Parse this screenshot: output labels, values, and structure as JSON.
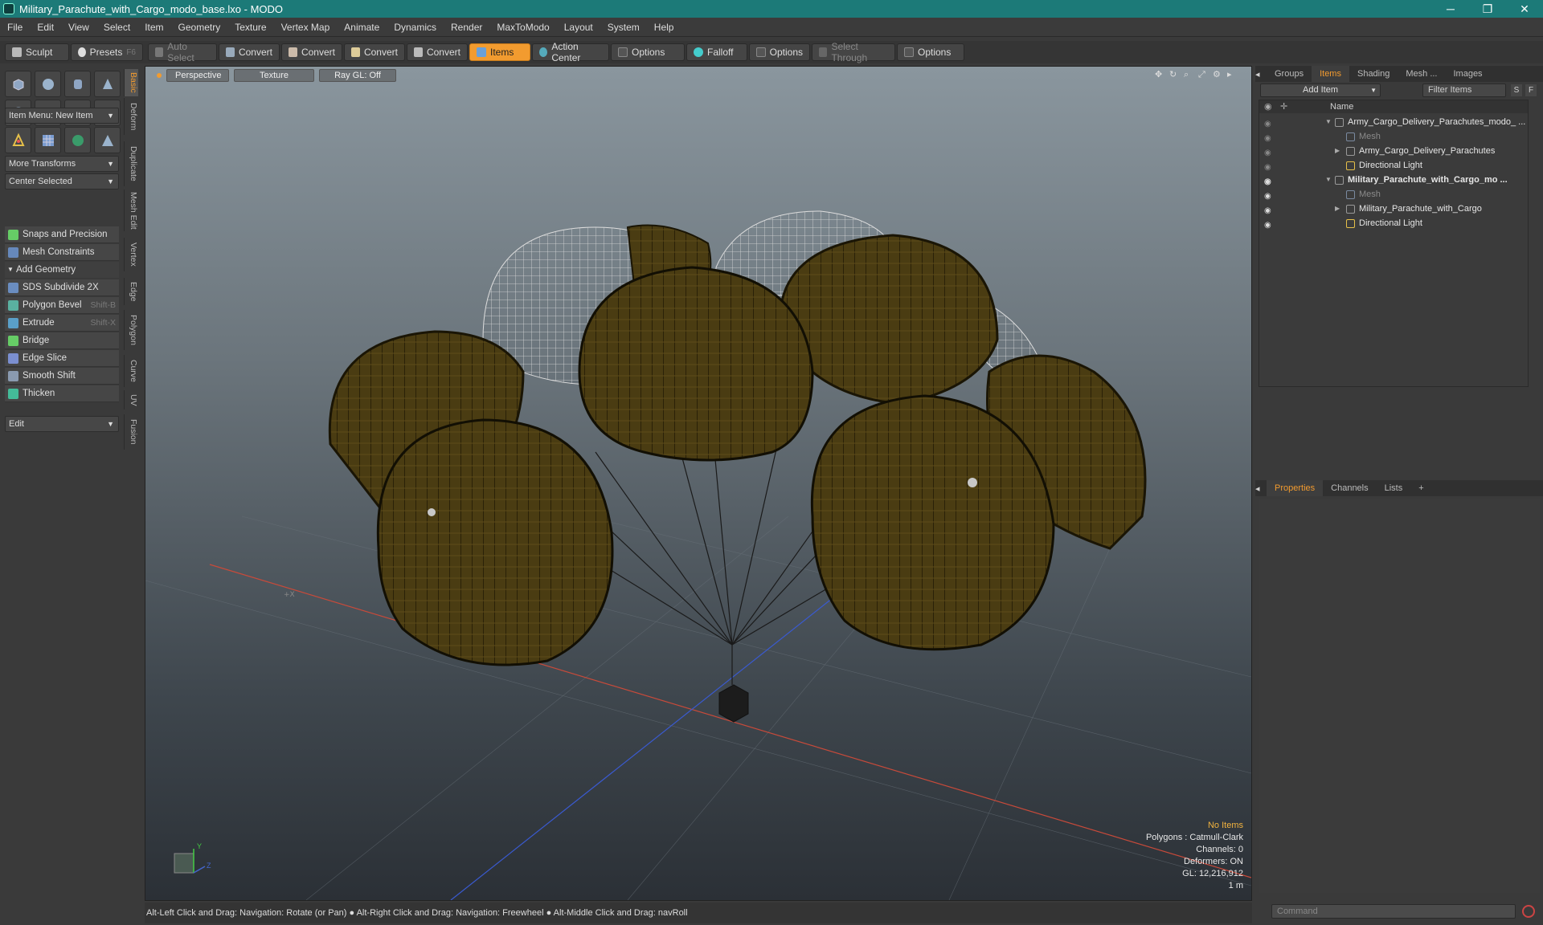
{
  "window": {
    "title": "Military_Parachute_with_Cargo_modo_base.lxo - MODO",
    "min": "─",
    "max": "❐",
    "close": "✕"
  },
  "menu": [
    "File",
    "Edit",
    "View",
    "Select",
    "Item",
    "Geometry",
    "Texture",
    "Vertex Map",
    "Animate",
    "Dynamics",
    "Render",
    "MaxToModo",
    "Layout",
    "System",
    "Help"
  ],
  "toolbar": {
    "sculpt": "Sculpt",
    "presets": "Presets",
    "presets_key": "F6",
    "auto_select": "Auto Select",
    "convert1": "Convert",
    "convert2": "Convert",
    "convert3": "Convert",
    "convert4": "Convert",
    "items": "Items",
    "action_center": "Action Center",
    "options1": "Options",
    "falloff": "Falloff",
    "options2": "Options",
    "select_through": "Select Through",
    "options3": "Options"
  },
  "left": {
    "item_menu": "Item Menu: New Item",
    "more_transforms": "More Transforms",
    "center_selected": "Center Selected",
    "snaps": "Snaps and Precision",
    "mesh_constraints": "Mesh Constraints",
    "add_geometry": "Add Geometry",
    "tools": [
      {
        "label": "SDS Subdivide 2X",
        "key": ""
      },
      {
        "label": "Polygon Bevel",
        "key": "Shift-B"
      },
      {
        "label": "Extrude",
        "key": "Shift-X"
      },
      {
        "label": "Bridge",
        "key": ""
      },
      {
        "label": "Edge Slice",
        "key": ""
      },
      {
        "label": "Smooth Shift",
        "key": ""
      },
      {
        "label": "Thicken",
        "key": ""
      }
    ],
    "edit": "Edit",
    "vtabs": [
      "Basic",
      "Deform",
      "Duplicate",
      "Mesh Edit",
      "Vertex",
      "Edge",
      "Polygon",
      "Curve",
      "UV",
      "Fusion"
    ]
  },
  "viewport": {
    "perspective": "Perspective",
    "texture": "Texture",
    "raygl": "Ray GL: Off",
    "hud": {
      "no_items": "No Items",
      "polygons": "Polygons : Catmull-Clark",
      "channels": "Channels: 0",
      "deformers": "Deformers: ON",
      "gl": "GL: 12,216,912",
      "scale": "1 m"
    },
    "axis_y": "Y",
    "axis_z": "Z"
  },
  "status": "Alt-Left Click and Drag: Navigation: Rotate (or Pan) ● Alt-Right Click and Drag: Navigation: Freewheel ● Alt-Middle Click and Drag: navRoll",
  "right": {
    "tabs_top": [
      "Groups",
      "Items",
      "Shading",
      "Mesh ...",
      "Images"
    ],
    "add_item": "Add Item",
    "filter_items": "Filter Items",
    "filter_s": "S",
    "filter_f": "F",
    "name_col": "Name",
    "tree": [
      {
        "label": "Army_Cargo_Delivery_Parachutes_modo_ ...",
        "bold": false
      },
      {
        "label": "Mesh",
        "bold": false
      },
      {
        "label": "Army_Cargo_Delivery_Parachutes",
        "bold": false
      },
      {
        "label": "Directional Light",
        "bold": false
      },
      {
        "label": "Military_Parachute_with_Cargo_mo ...",
        "bold": true
      },
      {
        "label": "Mesh",
        "bold": false
      },
      {
        "label": "Military_Parachute_with_Cargo",
        "bold": false
      },
      {
        "label": "Directional Light",
        "bold": false
      }
    ],
    "tabs_bottom": [
      "Properties",
      "Channels",
      "Lists"
    ],
    "command": "Command"
  },
  "colors": {
    "accent": "#f29b2f",
    "titlebar": "#1c7a78",
    "canopy": "#4a3c12"
  }
}
